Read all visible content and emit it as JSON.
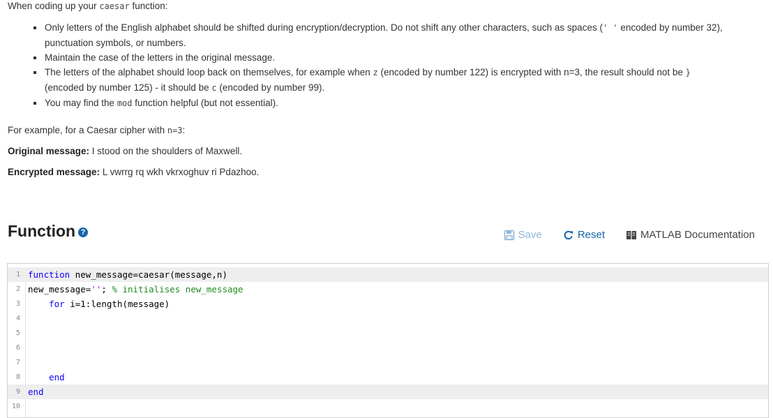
{
  "intro": {
    "prefix": "When coding up your ",
    "code": "caesar",
    "suffix": " function:"
  },
  "bullets": {
    "b1": {
      "text1": "Only letters of the English alphabet should be shifted during encryption/decryption. Do not shift any other characters, such as spaces (",
      "code": "' '",
      "text2": " encoded by number 32), punctuation symbols, or numbers."
    },
    "b2": {
      "text": "Maintain the case of the letters in the original message."
    },
    "b3": {
      "text1": "The letters of the alphabet should loop back on themselves, for example when ",
      "code1": "z",
      "text2": " (encoded by number 122) is encrypted with n=3, the result should not be ",
      "code2": "}",
      "text3": " (encoded by number 125) - it should be ",
      "code3": "c",
      "text4": " (encoded by number 99)."
    },
    "b4": {
      "text1": "You may find the ",
      "code": "mod",
      "text2": " function helpful (but not essential)."
    }
  },
  "example": {
    "prefix": "For example, for a Caesar cipher with ",
    "code": "n=3",
    "suffix": ":"
  },
  "original": {
    "label": "Original message:",
    "value": " I stood on the shoulders of Maxwell."
  },
  "encrypted": {
    "label": "Encrypted message:",
    "value": " L vwrrg rq wkh vkrxoghuv ri Pdazhoo."
  },
  "section": {
    "title": "Function",
    "help_icon": "?"
  },
  "toolbar": {
    "save": "Save",
    "reset": "Reset",
    "docs": "MATLAB Documentation"
  },
  "editor": {
    "line_numbers": [
      "1",
      "2",
      "3",
      "4",
      "5",
      "6",
      "7",
      "8",
      "9",
      "10"
    ],
    "l1_kw": "function",
    "l1_rest": " new_message=caesar(message,n)",
    "l2_a": "new_message=",
    "l2_str": "''",
    "l2_b": "; ",
    "l2_cm": "% initialises new_message",
    "l3_indent": "    ",
    "l3_kw": "for",
    "l3_rest": " i=1:length(message)",
    "l8_indent": "    ",
    "l8_kw": "end",
    "l9_kw": "end"
  }
}
